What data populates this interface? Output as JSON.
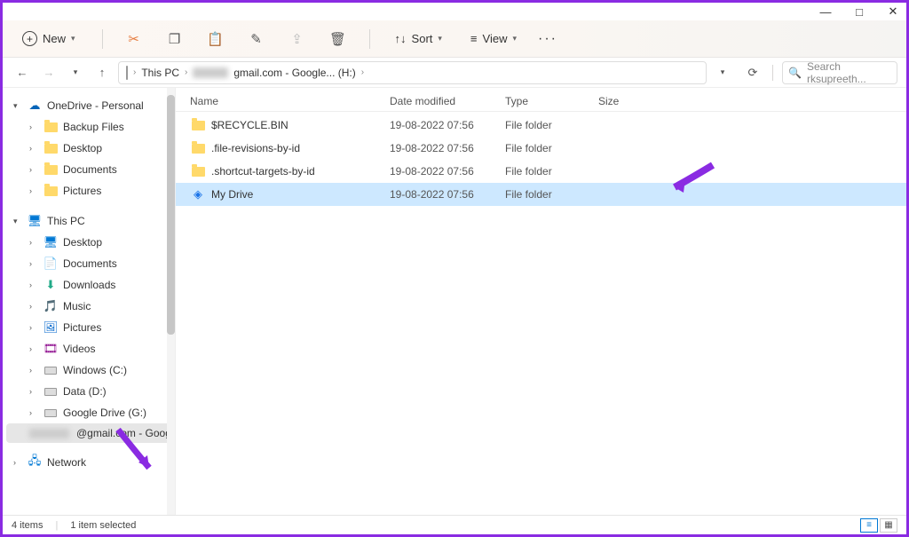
{
  "window": {
    "minimize": "—",
    "maximize": "□",
    "close": "✕"
  },
  "toolbar": {
    "new_label": "New",
    "sort_label": "Sort",
    "view_label": "View"
  },
  "breadcrumb": {
    "root": "This PC",
    "current": "gmail.com - Google... (H:)"
  },
  "search": {
    "placeholder": "Search rksupreeth..."
  },
  "sidebar": {
    "onedrive": {
      "label": "OneDrive - Personal"
    },
    "od_items": [
      {
        "label": "Backup Files"
      },
      {
        "label": "Desktop"
      },
      {
        "label": "Documents"
      },
      {
        "label": "Pictures"
      }
    ],
    "thispc": {
      "label": "This PC"
    },
    "pc_items": [
      {
        "label": "Desktop",
        "icon": "desktop"
      },
      {
        "label": "Documents",
        "icon": "doc"
      },
      {
        "label": "Downloads",
        "icon": "down"
      },
      {
        "label": "Music",
        "icon": "music"
      },
      {
        "label": "Pictures",
        "icon": "pic"
      },
      {
        "label": "Videos",
        "icon": "video"
      },
      {
        "label": "Windows (C:)",
        "icon": "drive"
      },
      {
        "label": "Data (D:)",
        "icon": "drive"
      },
      {
        "label": "Google Drive (G:)",
        "icon": "drive"
      }
    ],
    "selected": {
      "label": "@gmail.com - Goog"
    },
    "network": {
      "label": "Network"
    }
  },
  "columns": {
    "name": "Name",
    "date": "Date modified",
    "type": "Type",
    "size": "Size"
  },
  "files": [
    {
      "name": "$RECYCLE.BIN",
      "date": "19-08-2022 07:56",
      "type": "File folder",
      "size": "",
      "icon": "folder",
      "selected": false
    },
    {
      "name": ".file-revisions-by-id",
      "date": "19-08-2022 07:56",
      "type": "File folder",
      "size": "",
      "icon": "folder",
      "selected": false
    },
    {
      "name": ".shortcut-targets-by-id",
      "date": "19-08-2022 07:56",
      "type": "File folder",
      "size": "",
      "icon": "folder",
      "selected": false
    },
    {
      "name": "My Drive",
      "date": "19-08-2022 07:56",
      "type": "File folder",
      "size": "",
      "icon": "gdrive",
      "selected": true
    }
  ],
  "status": {
    "count": "4 items",
    "selected": "1 item selected"
  }
}
